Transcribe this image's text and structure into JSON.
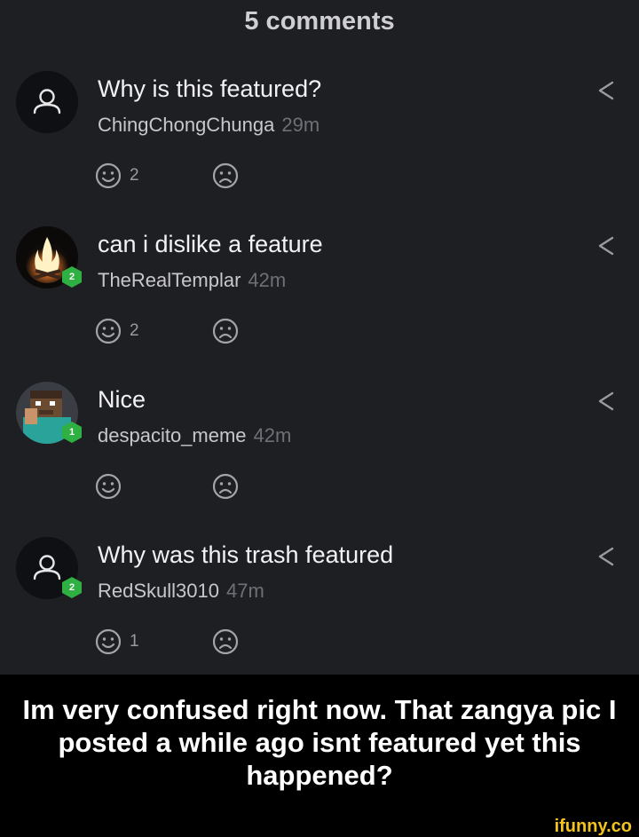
{
  "header": {
    "title": "5 comments"
  },
  "comments": [
    {
      "text": "Why is this featured?",
      "username": "ChingChongChunga",
      "time": "29m",
      "level": "",
      "avatar": "default-user-icon",
      "likes": "2",
      "dislikes": ""
    },
    {
      "text": "can i dislike a feature",
      "username": "TheRealTemplar",
      "time": "42m",
      "level": "2",
      "avatar": "campfire-avatar",
      "likes": "2",
      "dislikes": ""
    },
    {
      "text": "Nice",
      "username": "despacito_meme",
      "time": "42m",
      "level": "1",
      "avatar": "minecraft-character-avatar",
      "likes": "",
      "dislikes": ""
    },
    {
      "text": "Why was this trash featured",
      "username": "RedSkull3010",
      "time": "47m",
      "level": "2",
      "avatar": "default-user-icon",
      "likes": "1",
      "dislikes": ""
    }
  ],
  "caption": "Im very confused right now. That zangya pic I posted a while ago isnt featured yet this happened?",
  "brand": "ifunny.co",
  "colors": {
    "background": "#1e1f23",
    "badge": "#2fb043",
    "caption_bg": "#000000",
    "brand": "#f2c21e"
  }
}
